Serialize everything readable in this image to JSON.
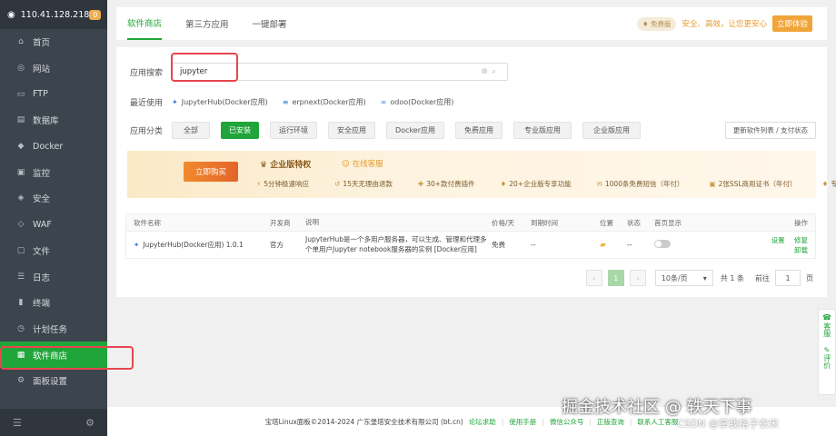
{
  "sidebar": {
    "ip": "110.41.128.218",
    "badge": "0",
    "items": [
      {
        "label": "首页",
        "icon": "home-icon",
        "glyph": "⌂"
      },
      {
        "label": "网站",
        "icon": "globe-icon",
        "glyph": "◎"
      },
      {
        "label": "FTP",
        "icon": "ftp-icon",
        "glyph": "▭"
      },
      {
        "label": "数据库",
        "icon": "database-icon",
        "glyph": "▤"
      },
      {
        "label": "Docker",
        "icon": "docker-icon",
        "glyph": "◆"
      },
      {
        "label": "监控",
        "icon": "monitor-icon",
        "glyph": "▣"
      },
      {
        "label": "安全",
        "icon": "shield-icon",
        "glyph": "◈"
      },
      {
        "label": "WAF",
        "icon": "waf-icon",
        "glyph": "◇"
      },
      {
        "label": "文件",
        "icon": "folder-icon",
        "glyph": "▢"
      },
      {
        "label": "日志",
        "icon": "log-icon",
        "glyph": "☰"
      },
      {
        "label": "终端",
        "icon": "terminal-icon",
        "glyph": "▮"
      },
      {
        "label": "计划任务",
        "icon": "clock-icon",
        "glyph": "◷"
      },
      {
        "label": "软件商店",
        "icon": "grid-icon",
        "glyph": "▦",
        "active": true
      },
      {
        "label": "面板设置",
        "icon": "settings-icon",
        "glyph": "⚙"
      }
    ]
  },
  "tabs": [
    "软件商店",
    "第三方应用",
    "一键部署"
  ],
  "promo": {
    "edition": "免费版",
    "text": "安全、高效，让您更安心",
    "button": "立即体验"
  },
  "search": {
    "label": "应用搜索",
    "value": "jupyter"
  },
  "recent": {
    "label": "最近使用",
    "items": [
      "JupyterHub(Docker应用)",
      "erpnext(Docker应用)",
      "odoo(Docker应用)"
    ]
  },
  "categories": {
    "label": "应用分类",
    "items": [
      {
        "label": "全部",
        "w": 42
      },
      {
        "label": "已安装",
        "w": 42,
        "active": true
      },
      {
        "label": "运行环境",
        "w": 52
      },
      {
        "label": "安全应用",
        "w": 52
      },
      {
        "label": "Docker应用",
        "w": 64
      },
      {
        "label": "免费应用",
        "w": 52
      },
      {
        "label": "专业版应用",
        "w": 64
      },
      {
        "label": "企业版应用",
        "w": 64
      }
    ],
    "update_button": "更新软件列表 / 支付状态"
  },
  "banner": {
    "buy": "立即购买",
    "title": "企业版特权",
    "service": "在线客服",
    "features": [
      "5分钟极速响应",
      "15天无理由退款",
      "30+款付费插件",
      "20+企业版专享功能",
      "1000条免费短信（年付）",
      "2张SSL商用证书（年付）",
      "专享企业服务"
    ]
  },
  "table": {
    "headers": [
      "软件名称",
      "开发商",
      "说明",
      "价格/天",
      "到期时间",
      "位置",
      "状态",
      "首页显示",
      "操作"
    ],
    "rows": [
      {
        "name": "JupyterHub(Docker应用) 1.0.1",
        "vendor": "官方",
        "desc": "JupyterHub是一个多用户服务器，可以生成、管理和代理多个单用户Jupyter notebook服务器的实例 [Docker应用]",
        "price": "免费",
        "expire": "--",
        "status": "--",
        "actions": [
          "设置",
          "修复",
          "卸载"
        ]
      }
    ]
  },
  "pager": {
    "prev": "‹",
    "current": "1",
    "next": "›",
    "size": "10条/页",
    "total": "共 1 条",
    "goto_label": "前往",
    "goto_value": "1",
    "page_unit": "页"
  },
  "side_float": [
    {
      "label": "客服",
      "glyph": "☎"
    },
    {
      "label": "评价",
      "glyph": "✎"
    }
  ],
  "footer": {
    "copyright": "宝塔Linux面板©2014-2024 广东堡塔安全技术有限公司 (bt.cn)",
    "links": [
      "论坛求助",
      "使用手册",
      "微信公众号",
      "正版查询",
      "联系人工客服"
    ]
  },
  "watermark": {
    "main": "掘金技术社区 @ 轶天下事",
    "sub": "CSDN @掌我格子衣米"
  }
}
